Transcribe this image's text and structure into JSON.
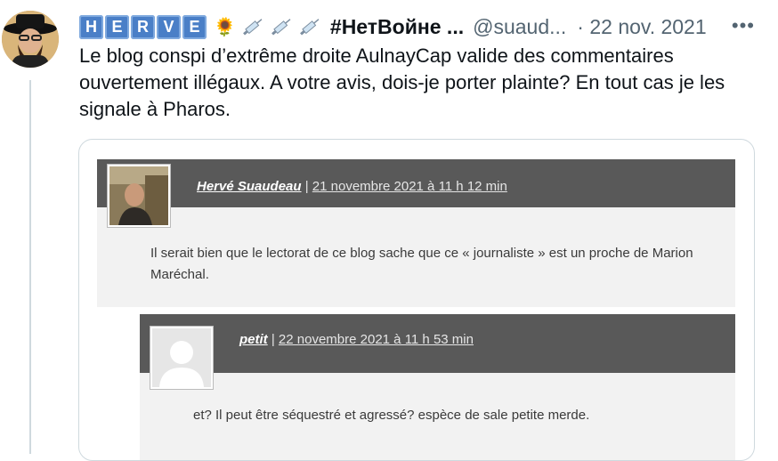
{
  "tweet": {
    "letters": [
      "H",
      "E",
      "R",
      "V",
      "E"
    ],
    "display_name": "#НетВойне ...",
    "handle": "@suaud...",
    "date": "· 22 nov. 2021",
    "more": "•••",
    "text": "Le blog conspi d’extrême droite AulnayCap valide des commentaires ouvertement illégaux. A votre avis, dois-je porter plainte? En tout cas je les signale à Pharos.",
    "emoji": "🌻"
  },
  "comments": [
    {
      "author": "Hervé Suaudeau",
      "separator": "|",
      "date": "21 novembre 2021 à 11 h 12 min",
      "text": "Il serait bien que le lectorat de ce blog sache que ce « journaliste » est un proche de Marion Maréchal."
    },
    {
      "author": "petit",
      "separator": "|",
      "date": "22 novembre 2021 à 11 h 53 min",
      "text": "et? Il peut être séquestré et agressé? espèce de sale petite merde."
    }
  ]
}
